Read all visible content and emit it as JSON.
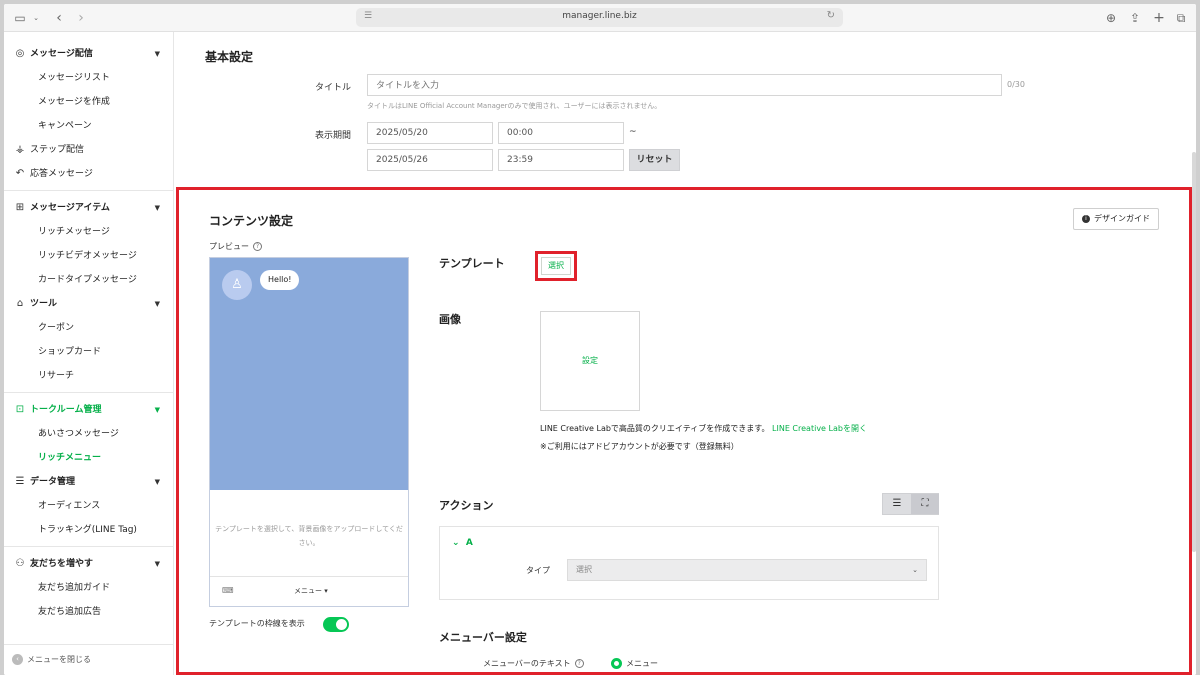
{
  "browser": {
    "url": "manager.line.biz"
  },
  "sidebar": {
    "groups": [
      {
        "label": "メッセージ配信",
        "items": [
          "メッセージリスト",
          "メッセージを作成",
          "キャンペーン"
        ]
      },
      {
        "label": "ステップ配信"
      },
      {
        "label": "応答メッセージ"
      },
      {
        "label": "メッセージアイテム",
        "items": [
          "リッチメッセージ",
          "リッチビデオメッセージ",
          "カードタイプメッセージ"
        ]
      },
      {
        "label": "ツール",
        "items": [
          "クーポン",
          "ショップカード",
          "リサーチ"
        ]
      },
      {
        "label": "トークルーム管理",
        "items": [
          "あいさつメッセージ",
          "リッチメニュー"
        ]
      },
      {
        "label": "データ管理",
        "items": [
          "オーディエンス",
          "トラッキング(LINE Tag)"
        ]
      },
      {
        "label": "友だちを増やす",
        "items": [
          "友だち追加ガイド",
          "友だち追加広告"
        ]
      }
    ],
    "close_label": "メニューを閉じる",
    "accent_color": "#06c755"
  },
  "basic": {
    "section_title": "基本設定",
    "title_label": "タイトル",
    "title_placeholder": "タイトルを入力",
    "title_count": "0/30",
    "title_hint": "タイトルはLINE Official Account Managerのみで使用され、ユーザーには表示されません。",
    "period_label": "表示期間",
    "start_date": "2025/05/20",
    "start_time": "00:00",
    "tilde": "~",
    "end_date": "2025/05/26",
    "end_time": "23:59",
    "reset_label": "リセット"
  },
  "content": {
    "section_title": "コンテンツ設定",
    "design_guide_label": "デザインガイド",
    "preview_label": "プレビュー",
    "preview_bubble": "Hello!",
    "preview_text": "テンプレートを選択して、背景画像をアップロードしてください。",
    "preview_menu": "メニュー ▾",
    "frame_toggle_label": "テンプレートの枠線を表示",
    "frame_toggle_on": true,
    "template_label": "テンプレート",
    "template_button": "選択",
    "image_label": "画像",
    "image_button": "設定",
    "creative_text": "LINE Creative Labで高品質のクリエイティブを作成できます。",
    "creative_link": "LINE Creative Labを開く",
    "creative_note": "※ご利用にはアドビアカウントが必要です（登録無料）",
    "action_label": "アクション",
    "action_item": "A",
    "action_type_label": "タイプ",
    "action_type_value": "選択",
    "menubar_label": "メニューバー設定",
    "menubar_text_label": "メニューバーのテキスト",
    "menubar_option": "メニュー"
  }
}
